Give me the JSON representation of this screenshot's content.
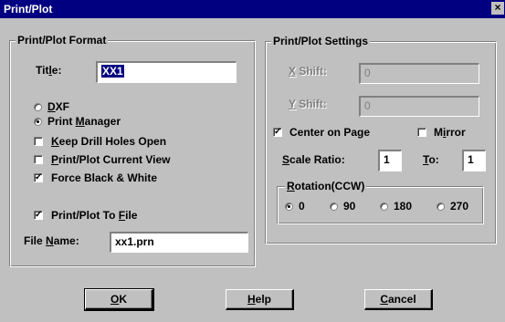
{
  "window": {
    "title": "Print/Plot",
    "close_glyph": "×"
  },
  "format_group": {
    "legend": "Print/Plot Format",
    "title_label": "Title:",
    "title_value": "XX1",
    "output_options": [
      {
        "label": "DXF",
        "selected": false
      },
      {
        "label": "Print Manager",
        "selected": true
      }
    ],
    "checkboxes": [
      {
        "label": "Keep Drill Holes Open",
        "checked": false
      },
      {
        "label": "Print/Plot Current View",
        "checked": false
      },
      {
        "label": "Force Black & White",
        "checked": true
      },
      {
        "label": "Print/Plot To File",
        "checked": true
      }
    ],
    "file_name_label": "File Name:",
    "file_name_value": "xx1.prn"
  },
  "settings_group": {
    "legend": "Print/Plot Settings",
    "x_shift_label": "X Shift:",
    "x_shift_value": "0",
    "y_shift_label": "Y Shift:",
    "y_shift_value": "0",
    "center_on_page": {
      "label": "Center on Page",
      "checked": true
    },
    "mirror": {
      "label": "Mirror",
      "checked": false
    },
    "scale_ratio_label": "Scale Ratio:",
    "scale_ratio_value": "1",
    "to_label": "To:",
    "to_value": "1",
    "rotation": {
      "legend": "Rotation(CCW)",
      "options": [
        {
          "label": "0",
          "selected": true
        },
        {
          "label": "90",
          "selected": false
        },
        {
          "label": "180",
          "selected": false
        },
        {
          "label": "270",
          "selected": false
        }
      ]
    }
  },
  "buttons": {
    "ok": "OK",
    "help": "Help",
    "cancel": "Cancel"
  }
}
